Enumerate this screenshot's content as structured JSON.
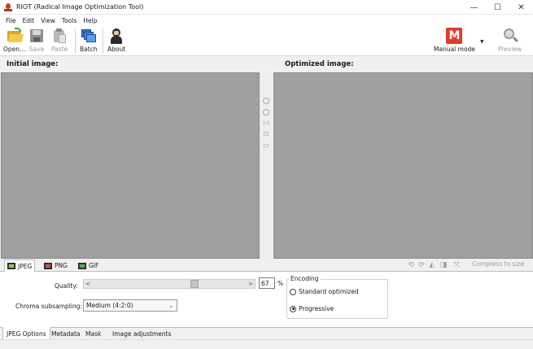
{
  "window": {
    "title": "RIOT (Radical Image Optimization Tool)",
    "controls": {
      "minimize": "—",
      "maximize": "☐",
      "close": "✕"
    }
  },
  "menu": [
    "File",
    "Edit",
    "View",
    "Tools",
    "Help"
  ],
  "toolbar": {
    "open_label": "Open...",
    "save_label": "Save",
    "paste_label": "Paste",
    "batch_label": "Batch",
    "about_label": "About",
    "mode_glyph": "M",
    "mode_label": "Manual mode",
    "mode_caret": "▼",
    "preview_label": "Preview"
  },
  "panels": {
    "initial_title": "Initial image:",
    "optimized_title": "Optimized image:"
  },
  "zoom": {
    "actual_size": "1:1"
  },
  "format_tabs": [
    {
      "label": "JPEG",
      "icon": "jpeg-file-icon"
    },
    {
      "label": "PNG",
      "icon": "png-file-icon"
    },
    {
      "label": "GIF",
      "icon": "gif-file-icon"
    }
  ],
  "tools": {
    "compress_label": "Compress to size",
    "glyphs": [
      "⟲",
      "⟳",
      "◭",
      "◨",
      "⤧"
    ]
  },
  "jpeg": {
    "quality_label": "Quality:",
    "quality_value": "67",
    "quality_fraction": 0.67,
    "percent": "%",
    "slider_left": "<",
    "slider_right": ">",
    "chroma_label": "Chroma subsampling:",
    "chroma_value": "Medium (4:2:0)",
    "chroma_caret": "⌄",
    "encoding": {
      "title": "Encoding",
      "standard": "Standard optimized",
      "progressive": "Progressive",
      "selected": "progressive"
    }
  },
  "option_tabs": [
    "JPEG Options",
    "Metadata",
    "Mask",
    "Image adjustments"
  ],
  "colors": {
    "image_bg": "#a0a0a0",
    "mode_badge": "#e53a2b"
  }
}
